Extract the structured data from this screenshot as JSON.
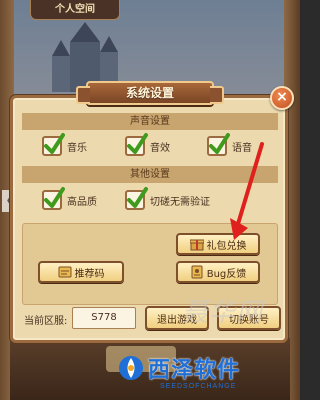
{
  "background": {
    "top_tab": "个人空间"
  },
  "dialog": {
    "title": "系统设置",
    "close_glyph": "×",
    "sections": {
      "sound": {
        "header": "声音设置",
        "options": [
          {
            "label": "音乐",
            "checked": true
          },
          {
            "label": "音效",
            "checked": true
          },
          {
            "label": "语音",
            "checked": true
          }
        ]
      },
      "other": {
        "header": "其他设置",
        "options": [
          {
            "label": "高品质",
            "checked": true
          },
          {
            "label": "切磋无需验证",
            "checked": true
          }
        ]
      }
    },
    "buttons": {
      "gift_code": "礼包兑换",
      "recommend_code": "推荐码",
      "bug_report": "Bug反馈",
      "exit_game": "退出游戏",
      "switch_account": "切换账号"
    },
    "server": {
      "label": "当前区服:",
      "value": "S778"
    }
  },
  "annotation": {
    "arrow_color": "#e0201c"
  },
  "watermark": {
    "script_text": "聂华网",
    "brand": "西泽软件",
    "domain": "SEEDSOFCHANGE"
  },
  "colors": {
    "panel": "#ecd9ae",
    "border": "#9b6a3e",
    "check": "#3f9a1e"
  }
}
